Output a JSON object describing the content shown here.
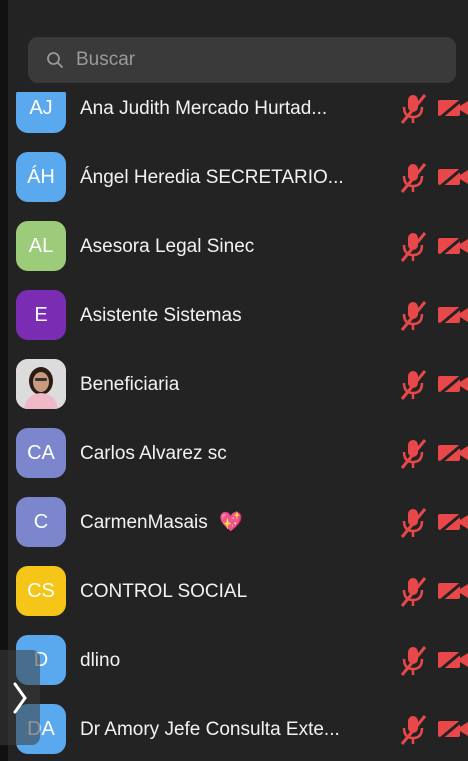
{
  "search": {
    "placeholder": "Buscar"
  },
  "colors": {
    "mic_muted": "#e8484a",
    "camera_off": "#e8484a"
  },
  "participants": [
    {
      "initials": "AJ",
      "name": "Ana Judith Mercado Hurtad...",
      "color": "#5aa8ee",
      "mic": "muted-mic-icon",
      "camera": "video-off-icon"
    },
    {
      "initials": "ÁH",
      "name": "Ángel Heredia SECRETARIO...",
      "color": "#5aa8ee",
      "mic": "muted-mic-icon",
      "camera": "video-off-icon"
    },
    {
      "initials": "AL",
      "name": "Asesora Legal Sinec",
      "color": "#9ccc7a",
      "mic": "muted-mic-icon",
      "camera": "video-off-icon"
    },
    {
      "initials": "E",
      "name": "Asistente Sistemas",
      "color": "#7a2db3",
      "mic": "muted-mic-icon",
      "camera": "video-off-icon"
    },
    {
      "initials": "",
      "name": "Beneficiaria",
      "color": "#d8d8d8",
      "photo": true,
      "mic": "muted-mic-icon",
      "camera": "video-off-icon"
    },
    {
      "initials": "CA",
      "name": "Carlos Alvarez sc",
      "color": "#7b86cc",
      "mic": "muted-mic-icon",
      "camera": "video-off-icon"
    },
    {
      "initials": "C",
      "name": "CarmenMasais",
      "emoji": "💖",
      "color": "#7b86cc",
      "mic": "muted-mic-icon",
      "camera": "video-off-icon"
    },
    {
      "initials": "CS",
      "name": "CONTROL SOCIAL",
      "color": "#f5c518",
      "mic": "muted-mic-icon",
      "camera": "video-off-icon"
    },
    {
      "initials": "D",
      "name": "dlino",
      "color": "#5aa8ee",
      "mic": "muted-mic-icon",
      "camera": "video-off-icon"
    },
    {
      "initials": "DA",
      "name": "Dr Amory Jefe Consulta Exte...",
      "color": "#5aa8ee",
      "mic": "muted-mic-icon",
      "camera": "video-off-icon"
    }
  ]
}
